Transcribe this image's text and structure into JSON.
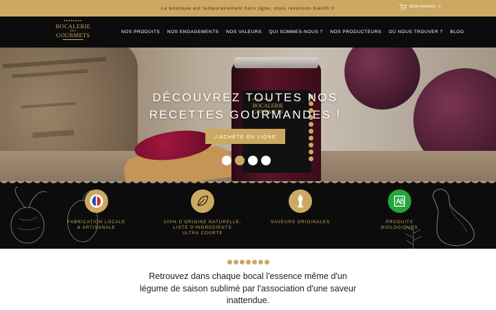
{
  "topbar": {
    "announcement": "La boutique est temporairement hors ligne, nous revenons bientô t!",
    "cart_label": "MON PANIER",
    "cart_count": "0"
  },
  "logo": {
    "line1": "BOCALERIE",
    "line2": "DES",
    "line3": "GOURMETS"
  },
  "nav": {
    "items": [
      "NOS PRODUITS",
      "NOS ENGAGEMENTS",
      "NOS VALEURS",
      "QUI SOMMES-NOUS ?",
      "NOS PRODUCTEURS",
      "OÙ NOUS TROUVER ?",
      "BLOG"
    ]
  },
  "hero": {
    "title_line1": "DÉCOUVREZ TOUTES NOS",
    "title_line2": "RECETTES GOURMANDES !",
    "cta_label": "J'ACHÈTE EN LIGNE",
    "slides_count": 4,
    "active_slide": 2
  },
  "features": [
    {
      "icon": "france-map-icon",
      "label": "FABRICATION LOCALE\n& ARTISANALE"
    },
    {
      "icon": "leaf-icon",
      "label": "100% D'ORIGINE NATURELLE,\nLISTE D'INGREDIENTS\nULTRA COURTE"
    },
    {
      "icon": "pepper-mill-icon",
      "label": "SAVEURS ORIGINALES"
    },
    {
      "icon": "organic-ab-icon",
      "label": "PRODUITS\nBIOLOGIQUES"
    }
  ],
  "intro": {
    "text": "Retrouvez dans chaque bocal l'essence même d'un légume de saison sublimé par l'association d'une saveur inattendue."
  },
  "colors": {
    "gold": "#cba962",
    "black": "#0c0c0c",
    "organic_green": "#23a63a"
  }
}
